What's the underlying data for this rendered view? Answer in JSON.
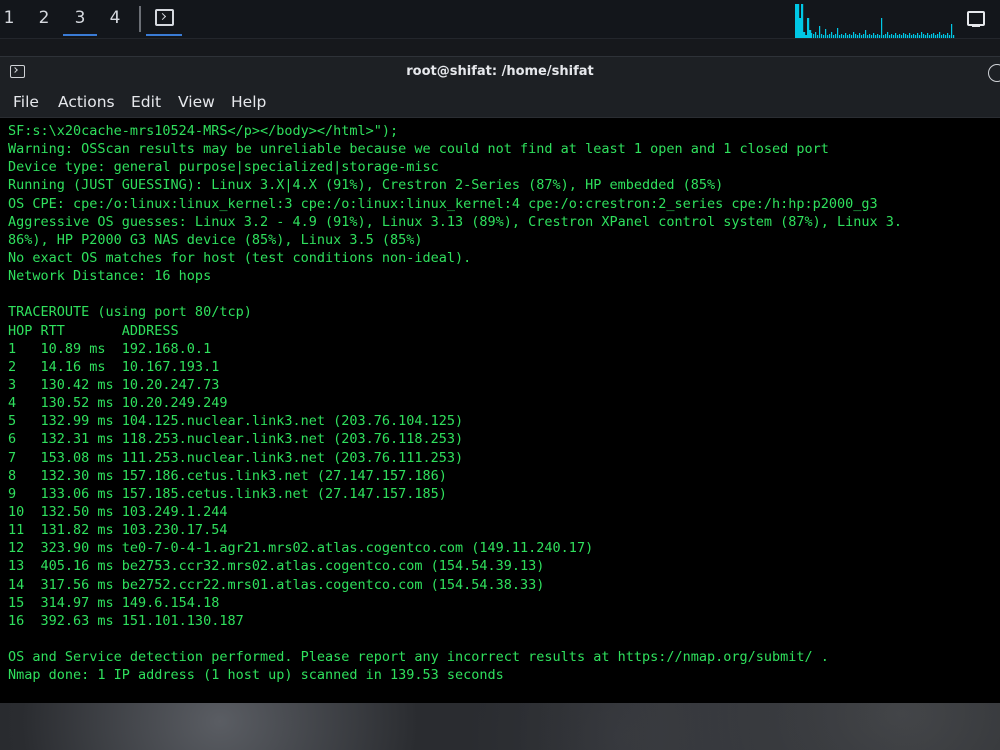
{
  "panel": {
    "workspaces": [
      "1",
      "2",
      "3",
      "4"
    ],
    "active_workspace": "3",
    "launcher_icon": "terminal-icon",
    "monitor_icon": "display-icon",
    "cpu_graph_color": "#00c8e6"
  },
  "window": {
    "title": "root@shifat: /home/shifat",
    "icon": "terminal-icon",
    "menu": [
      "File",
      "Actions",
      "Edit",
      "View",
      "Help"
    ]
  },
  "terminal": {
    "text_color": "#2fe05d",
    "lines": [
      "SF:s:\\x20cache-mrs10524-MRS</p></body></html>\");",
      "Warning: OSScan results may be unreliable because we could not find at least 1 open and 1 closed port",
      "Device type: general purpose|specialized|storage-misc",
      "Running (JUST GUESSING): Linux 3.X|4.X (91%), Crestron 2-Series (87%), HP embedded (85%)",
      "OS CPE: cpe:/o:linux:linux_kernel:3 cpe:/o:linux:linux_kernel:4 cpe:/o:crestron:2_series cpe:/h:hp:p2000_g3",
      "Aggressive OS guesses: Linux 3.2 - 4.9 (91%), Linux 3.13 (89%), Crestron XPanel control system (87%), Linux 3.",
      "86%), HP P2000 G3 NAS device (85%), Linux 3.5 (85%)",
      "No exact OS matches for host (test conditions non-ideal).",
      "Network Distance: 16 hops",
      "",
      "TRACEROUTE (using port 80/tcp)",
      "HOP RTT       ADDRESS",
      "1   10.89 ms  192.168.0.1",
      "2   14.16 ms  10.167.193.1",
      "3   130.42 ms 10.20.247.73",
      "4   130.52 ms 10.20.249.249",
      "5   132.99 ms 104.125.nuclear.link3.net (203.76.104.125)",
      "6   132.31 ms 118.253.nuclear.link3.net (203.76.118.253)",
      "7   153.08 ms 111.253.nuclear.link3.net (203.76.111.253)",
      "8   132.30 ms 157.186.cetus.link3.net (27.147.157.186)",
      "9   133.06 ms 157.185.cetus.link3.net (27.147.157.185)",
      "10  132.50 ms 103.249.1.244",
      "11  131.82 ms 103.230.17.54",
      "12  323.90 ms te0-7-0-4-1.agr21.mrs02.atlas.cogentco.com (149.11.240.17)",
      "13  405.16 ms be2753.ccr32.mrs02.atlas.cogentco.com (154.54.39.13)",
      "14  317.56 ms be2752.ccr22.mrs01.atlas.cogentco.com (154.54.38.33)",
      "15  314.97 ms 149.6.154.18",
      "16  392.63 ms 151.101.130.187",
      "",
      "OS and Service detection performed. Please report any incorrect results at https://nmap.org/submit/ .",
      "Nmap done: 1 IP address (1 host up) scanned in 139.53 seconds"
    ]
  }
}
